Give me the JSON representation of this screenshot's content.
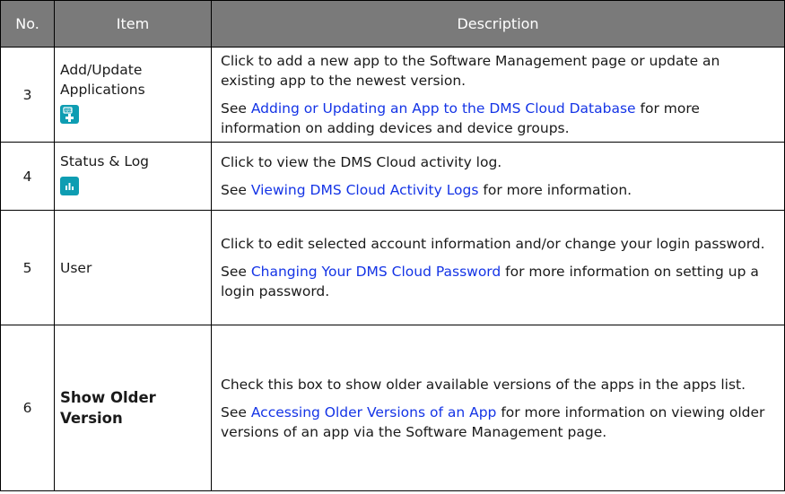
{
  "headers": {
    "no": "No.",
    "item": "Item",
    "description": "Description"
  },
  "rows": [
    {
      "no": "3",
      "item_line1": "Add/Update",
      "item_line2": "Applications",
      "icon": "add-app-icon",
      "p1": "Click to add a new app to the Software Management page or update an existing app to the newest version.",
      "p2_pre": "See ",
      "p2_link": "Adding or Updating an App to the DMS Cloud Database",
      "p2_post": " for more information on adding devices and device groups."
    },
    {
      "no": "4",
      "item": "Status & Log",
      "icon": "status-log-chart-icon",
      "p1": "Click to view the DMS Cloud activity log.",
      "p2_pre": "See ",
      "p2_link": "Viewing DMS Cloud Activity Logs",
      "p2_post": " for more information."
    },
    {
      "no": "5",
      "item": "User",
      "p1": "Click to edit selected account information and/or change your login password.",
      "p2_pre": "See ",
      "p2_link": "Changing Your DMS Cloud Password",
      "p2_post": " for more information on setting up a login password."
    },
    {
      "no": "6",
      "item_line1": "Show Older",
      "item_line2": "Version",
      "p1": "Check this box to show older available versions of the apps in the apps list.",
      "p2_pre": "See ",
      "p2_link": "Accessing Older Versions of an App",
      "p2_post": " for more information on viewing older versions of an app via the Software Management page."
    }
  ],
  "colors": {
    "header_bg": "#7a7a7a",
    "link": "#1434e6",
    "icon_bg": "#0e9db2"
  }
}
